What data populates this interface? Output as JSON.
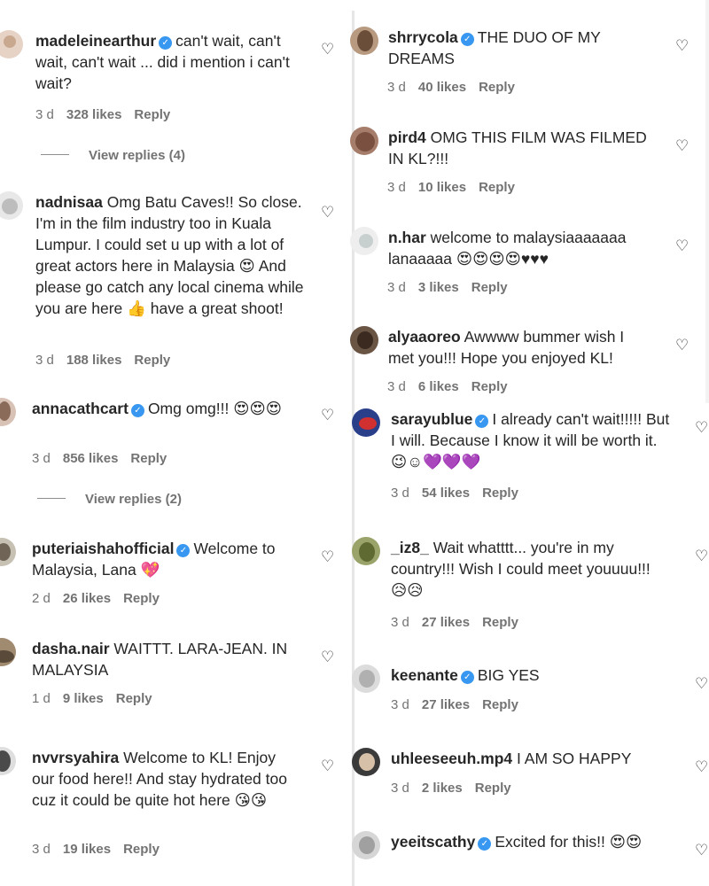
{
  "icons": {
    "heart": "heart-outline-icon",
    "verified": "verified-badge-icon"
  },
  "colors": {
    "verified": "#3897f0",
    "muted": "#737373",
    "text": "#262626"
  },
  "left": [
    {
      "user": "madeleinearthur",
      "verified": true,
      "text": "can't wait, can't wait, can't wait ... did i mention i can't wait?",
      "time": "3 d",
      "likes": "328 likes",
      "reply": "Reply",
      "view_replies": "View replies (4)"
    },
    {
      "user": "nadnisaa",
      "verified": false,
      "text": "Omg Batu Caves!! So close. I'm in the film industry too in Kuala Lumpur. I could set u up with a lot of great actors here in Malaysia 😍 And please go catch any local cinema while you are here 👍 have a great shoot!",
      "time": "3 d",
      "likes": "188 likes",
      "reply": "Reply"
    },
    {
      "user": "annacathcart",
      "verified": true,
      "text": "Omg omg!!! 😍😍😍",
      "time": "3 d",
      "likes": "856 likes",
      "reply": "Reply",
      "view_replies": "View replies (2)"
    },
    {
      "user": "puteriaishahofficial",
      "verified": true,
      "text": "Welcome to Malaysia, Lana 💖",
      "time": "2 d",
      "likes": "26 likes",
      "reply": "Reply"
    },
    {
      "user": "dasha.nair",
      "verified": false,
      "text": "WAITTT. LARA-JEAN. IN MALAYSIA",
      "time": "1 d",
      "likes": "9 likes",
      "reply": "Reply"
    },
    {
      "user": "nvvrsyahira",
      "verified": false,
      "text": "Welcome to KL! Enjoy our food here!! And stay hydrated too cuz it could be quite hot here 😘😘",
      "time": "3 d",
      "likes": "19 likes",
      "reply": "Reply"
    }
  ],
  "right": [
    {
      "user": "shrrycola",
      "verified": true,
      "text": "THE DUO OF MY DREAMS",
      "time": "3 d",
      "likes": "40 likes",
      "reply": "Reply"
    },
    {
      "user": "pird4",
      "verified": false,
      "text": "OMG THIS FILM WAS FILMED IN KL?!!!",
      "time": "3 d",
      "likes": "10 likes",
      "reply": "Reply"
    },
    {
      "user": "n.har",
      "verified": false,
      "text": "welcome to malaysiaaaaaaa lanaaaaa 😍😍😍😍♥♥♥",
      "time": "3 d",
      "likes": "3 likes",
      "reply": "Reply"
    },
    {
      "user": "alyaaoreo",
      "verified": false,
      "text": "Awwww bummer wish I met you!!! Hope you enjoyed KL!",
      "time": "3 d",
      "likes": "6 likes",
      "reply": "Reply"
    },
    {
      "user": "sarayublue",
      "verified": true,
      "text": "I already can't wait!!!!! But I will. Because I know it will be worth it. 😉☺💜💜💜",
      "time": "3 d",
      "likes": "54 likes",
      "reply": "Reply"
    },
    {
      "user": "_iz8_",
      "verified": false,
      "text": "Wait whatttt... you're in my country!!! Wish I could meet youuuu!!!😥😥",
      "time": "3 d",
      "likes": "27 likes",
      "reply": "Reply"
    },
    {
      "user": "keenante",
      "verified": true,
      "text": "BIG YES",
      "time": "3 d",
      "likes": "27 likes",
      "reply": "Reply"
    },
    {
      "user": "uhleeseeuh.mp4",
      "verified": false,
      "text": "I AM SO HAPPY",
      "time": "3 d",
      "likes": "2 likes",
      "reply": "Reply"
    },
    {
      "user": "yeeitscathy",
      "verified": true,
      "text": "Excited for this!! 😍😍",
      "time": "",
      "likes": "",
      "reply": ""
    }
  ]
}
